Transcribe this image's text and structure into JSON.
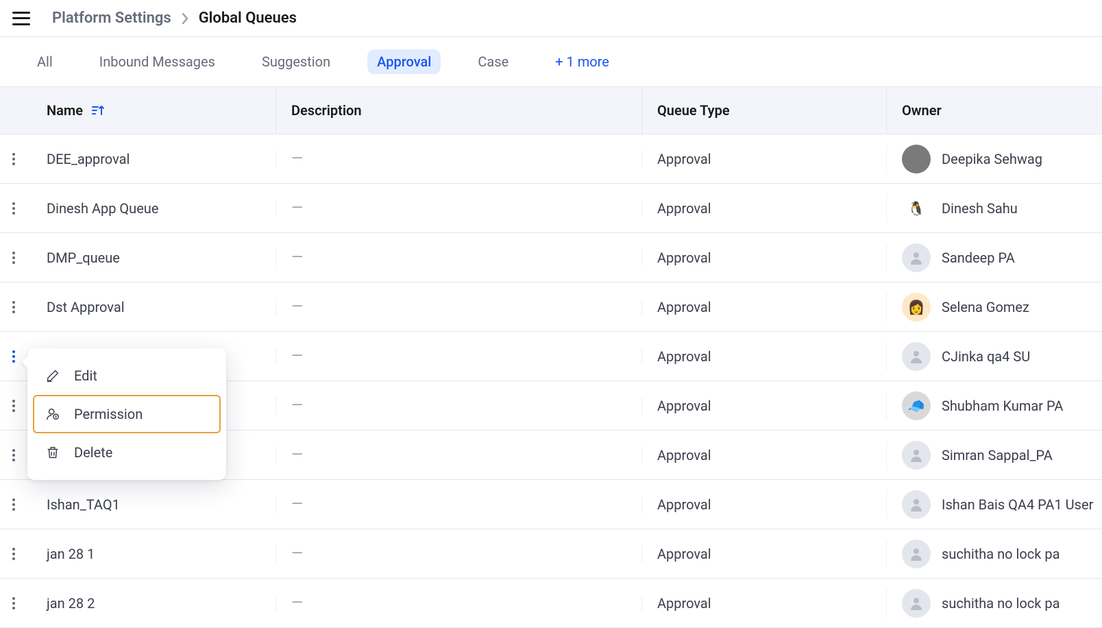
{
  "breadcrumb": {
    "parent": "Platform Settings",
    "current": "Global Queues"
  },
  "tabs": {
    "items": [
      {
        "label": "All",
        "active": false
      },
      {
        "label": "Inbound Messages",
        "active": false
      },
      {
        "label": "Suggestion",
        "active": false
      },
      {
        "label": "Approval",
        "active": true
      },
      {
        "label": "Case",
        "active": false
      }
    ],
    "more_label": "+ 1 more"
  },
  "columns": {
    "name": "Name",
    "description": "Description",
    "queue_type": "Queue Type",
    "owner": "Owner"
  },
  "empty_dash": "—",
  "rows": [
    {
      "name": "DEE_approval",
      "description": "",
      "queue_type": "Approval",
      "owner": "Deepika Sehwag",
      "avatar": "c1"
    },
    {
      "name": "Dinesh App Queue",
      "description": "",
      "queue_type": "Approval",
      "owner": "Dinesh Sahu",
      "avatar": "c2"
    },
    {
      "name": "DMP_queue",
      "description": "",
      "queue_type": "Approval",
      "owner": "Sandeep PA",
      "avatar": "placeholder"
    },
    {
      "name": "Dst Approval",
      "description": "",
      "queue_type": "Approval",
      "owner": "Selena Gomez",
      "avatar": "c4"
    },
    {
      "name": "",
      "description": "",
      "queue_type": "Approval",
      "owner": "CJinka qa4 SU",
      "avatar": "placeholder",
      "menu_open": true
    },
    {
      "name": "",
      "description": "",
      "queue_type": "Approval",
      "owner": "Shubham Kumar PA",
      "avatar": "c5"
    },
    {
      "name": "",
      "description": "",
      "queue_type": "Approval",
      "owner": "Simran Sappal_PA",
      "avatar": "placeholder"
    },
    {
      "name": "Ishan_TAQ1",
      "description": "",
      "queue_type": "Approval",
      "owner": "Ishan Bais QA4 PA1 User",
      "avatar": "placeholder"
    },
    {
      "name": "jan 28 1",
      "description": "",
      "queue_type": "Approval",
      "owner": "suchitha no lock pa",
      "avatar": "placeholder"
    },
    {
      "name": "jan 28 2",
      "description": "",
      "queue_type": "Approval",
      "owner": "suchitha no lock pa",
      "avatar": "placeholder"
    }
  ],
  "context_menu": {
    "edit": "Edit",
    "permission": "Permission",
    "delete": "Delete"
  }
}
